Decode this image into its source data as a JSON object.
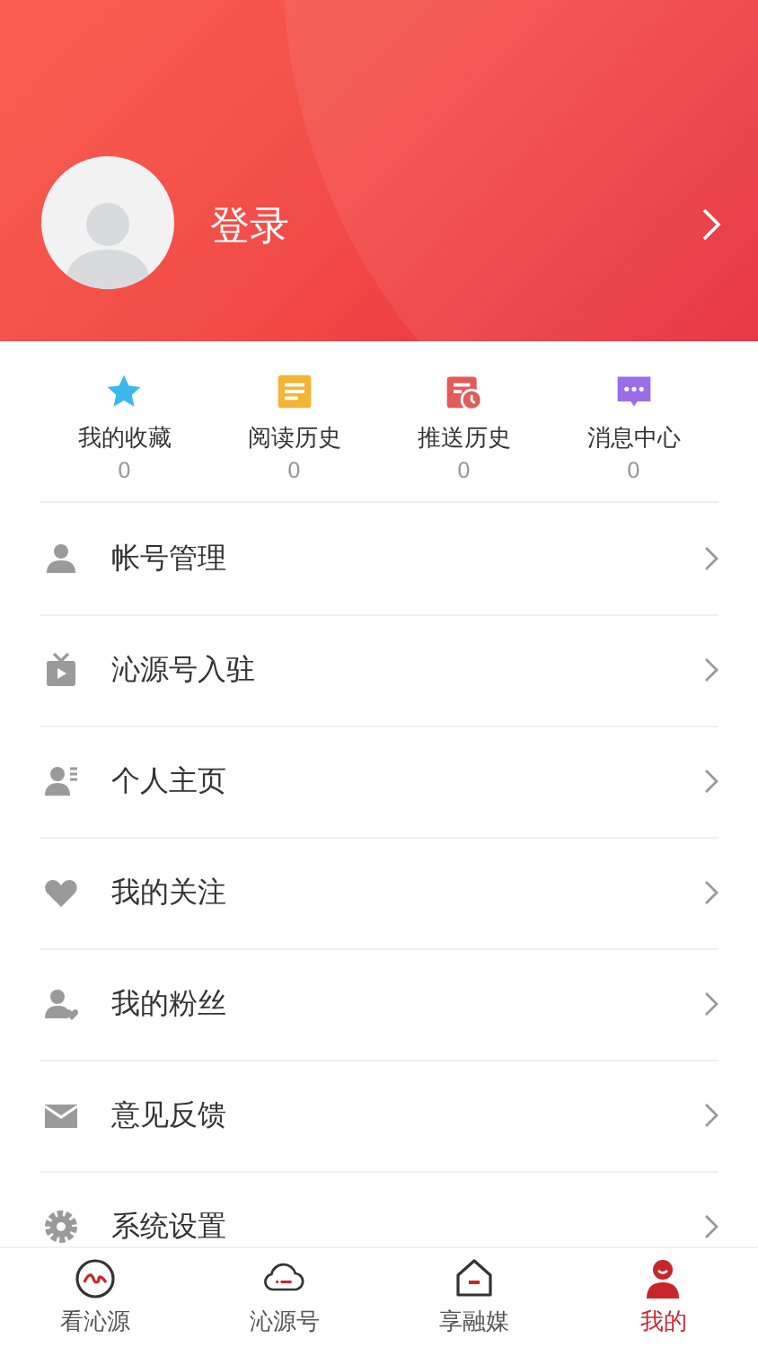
{
  "header": {
    "login_label": "登录"
  },
  "stats": [
    {
      "kind": "favorites",
      "label": "我的收藏",
      "count": "0"
    },
    {
      "kind": "history",
      "label": "阅读历史",
      "count": "0"
    },
    {
      "kind": "push",
      "label": "推送历史",
      "count": "0"
    },
    {
      "kind": "messages",
      "label": "消息中心",
      "count": "0"
    }
  ],
  "menu": [
    {
      "kind": "account",
      "label": "帐号管理"
    },
    {
      "kind": "tv",
      "label": "沁源号入驻"
    },
    {
      "kind": "profile",
      "label": "个人主页"
    },
    {
      "kind": "follow",
      "label": "我的关注"
    },
    {
      "kind": "fans",
      "label": "我的粉丝"
    },
    {
      "kind": "feedback",
      "label": "意见反馈"
    },
    {
      "kind": "settings",
      "label": "系统设置"
    }
  ],
  "tabs": [
    {
      "kind": "watch",
      "label": "看沁源",
      "selected": false
    },
    {
      "kind": "channel",
      "label": "沁源号",
      "selected": false
    },
    {
      "kind": "media",
      "label": "享融媒",
      "selected": false
    },
    {
      "kind": "me",
      "label": "我的",
      "selected": true
    }
  ]
}
